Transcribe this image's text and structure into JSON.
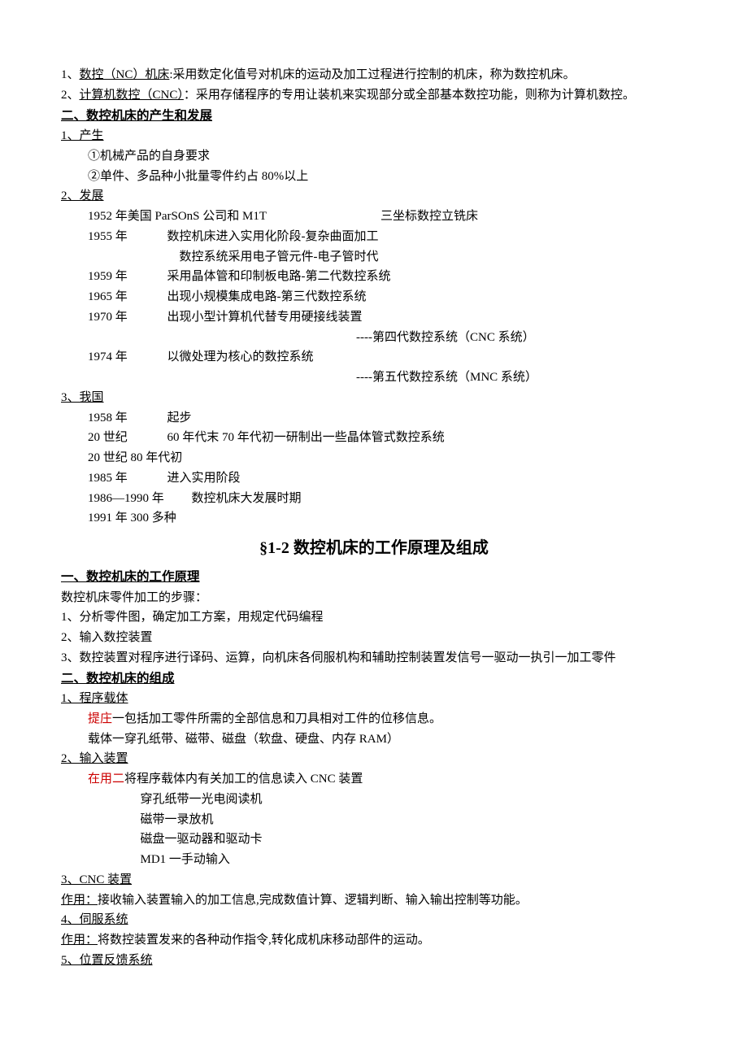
{
  "def1_num": "1、",
  "def1_term": "数控（NC）机床",
  "def1_rest": ":采用数定化值号对机床的运动及加工过程进行控制的机床，称为数控机床。",
  "def2_num": "2、",
  "def2_term": "计算机数控（CNC）",
  "def2_rest": "：采用存储程序的专用让装机来实现部分或全部基本数控功能，则称为计算机数控。",
  "h2": "二、数控机床的产生和发展",
  "s2_1": "1、产生",
  "s2_1_a": "①机械产品的自身要求",
  "s2_1_b": "②单件、多品种小批量零件约占 80%以上",
  "s2_2": "2、发展",
  "dev_1952_a": "1952 年美国 ParSOnS 公司和 M1T",
  "dev_1952_b": "三坐标数控立铣床",
  "dev_1955_y": "1955 年",
  "dev_1955_a": "数控机床进入实用化阶段-复杂曲面加工",
  "dev_1955_b": "数控系统采用电子管元件-电子管时代",
  "dev_1959_y": "1959 年",
  "dev_1959": "采用晶体管和印制板电路-第二代数控系统",
  "dev_1965_y": "1965 年",
  "dev_1965": "出现小规模集成电路-第三代数控系统",
  "dev_1970_y": "1970 年",
  "dev_1970": "出现小型计算机代替专用硬接线装置",
  "dev_1970_b": "----第四代数控系统（CNC 系统）",
  "dev_1974_y": "1974 年",
  "dev_1974": "以微处理为核心的数控系统",
  "dev_1974_b": "----第五代数控系统（MNC 系统）",
  "s2_3": "3、我国",
  "cn_1958_y": "1958 年",
  "cn_1958": "起步",
  "cn_6070_y": "20 世纪",
  "cn_6070": "60 年代末 70 年代初一研制出一些晶体管式数控系统",
  "cn_80": "20 世纪 80 年代初",
  "cn_1985_y": "1985 年",
  "cn_1985": "进入实用阶段",
  "cn_8690_y": "1986—1990 年",
  "cn_8690": "数控机床大发展时期",
  "cn_1991": "1991 年 300 多种",
  "sec12": "§1-2 数控机床的工作原理及组成",
  "h3": "一、数控机床的工作原理",
  "wp0": "数控机床零件加工的步骤：",
  "wp1": "1、分析零件图，确定加工方案，用规定代码编程",
  "wp2": "2、输入数控装置",
  "wp3": "3、数控装置对程序进行译码、运算，向机床各伺服机构和辅助控制装置发信号一驱动一执引一加工零件",
  "h4": "二、数控机床的组成",
  "c1": "1、程序载体",
  "c1_red": "提庄",
  "c1_rest": "一包括加工零件所需的全部信息和刀具相对工件的位移信息。",
  "c1_b": "载体一穿孔纸带、磁带、磁盘（软盘、硬盘、内存 RAM）",
  "c2": "2、输入装置",
  "c2_red": "在用二",
  "c2_rest": "将程序载体内有关加工的信息读入 CNC 装置",
  "c2_a": "穿孔纸带一光电阅读机",
  "c2_b": "磁带一录放机",
  "c2_c": "磁盘一驱动器和驱动卡",
  "c2_d": "MD1 一手动输入",
  "c3": "3、CNC 装置",
  "c3_use_label": "作用：",
  "c3_use": "接收输入装置输入的加工信息,完成数值计算、逻辑判断、输入输出控制等功能。",
  "c4": "4、伺服系统",
  "c4_use_label": "作用：",
  "c4_use": "将数控装置发来的各种动作指令,转化成机床移动部件的运动。",
  "c5": "5、位置反馈系统"
}
